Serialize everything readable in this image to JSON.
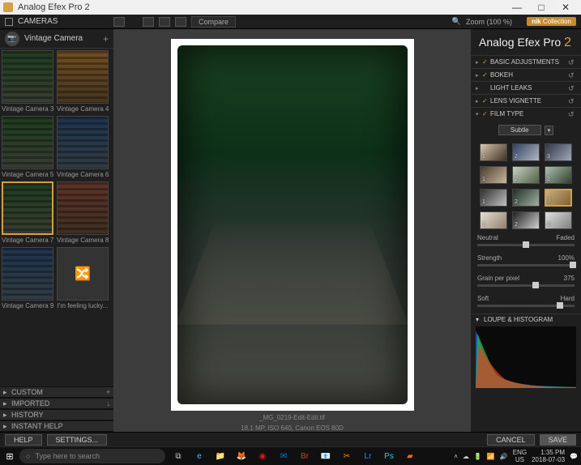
{
  "window": {
    "title": "Analog Efex Pro 2"
  },
  "toolbar": {
    "left_label": "CAMERAS",
    "compare": "Compare",
    "zoom": "Zoom (100 %)",
    "nik": "Collection"
  },
  "camera_header": {
    "label": "Vintage Camera"
  },
  "thumbs": [
    {
      "label": "Vintage Camera 3",
      "tone": ""
    },
    {
      "label": "Vintage Camera 4",
      "tone": "warm"
    },
    {
      "label": "Vintage Camera 5",
      "tone": ""
    },
    {
      "label": "Vintage Camera 6",
      "tone": "blue"
    },
    {
      "label": "Vintage Camera 7",
      "tone": "",
      "selected": true
    },
    {
      "label": "Vintage Camera 8",
      "tone": "red"
    },
    {
      "label": "Vintage Camera 9",
      "tone": "blue"
    },
    {
      "label": "I'm feeling lucky...",
      "lucky": true
    }
  ],
  "sections": {
    "custom": "CUSTOM",
    "imported": "IMPORTED",
    "history": "HISTORY",
    "instant": "INSTANT HELP"
  },
  "image_meta": {
    "filename": "_MG_0219-Edit-Edit.tif",
    "info": "18.1 MP, ISO 640, Canon EOS 80D"
  },
  "right": {
    "app": "Analog Efex Pro",
    "ver": "2",
    "adjustments": [
      {
        "label": "BASIC ADJUSTMENTS",
        "checked": true
      },
      {
        "label": "BOKEH",
        "checked": true
      },
      {
        "label": "LIGHT LEAKS",
        "checked": false
      },
      {
        "label": "LENS VIGNETTE",
        "checked": true
      },
      {
        "label": "FILM TYPE",
        "checked": true,
        "expanded": true
      }
    ],
    "subtle": "Subtle",
    "film_swatches": [
      {
        "n": "1",
        "g": "linear-gradient(135deg,#d8c8b0,#403020)"
      },
      {
        "n": "2",
        "g": "linear-gradient(135deg,#304060,#b0b8c0)"
      },
      {
        "n": "3",
        "g": "linear-gradient(135deg,#303848,#a0a8b8)"
      },
      {
        "n": "1",
        "g": "linear-gradient(135deg,#4a3a2a,#c8b8a0)"
      },
      {
        "n": "2",
        "g": "linear-gradient(135deg,#c8d0c0,#506048)"
      },
      {
        "n": "3",
        "g": "linear-gradient(135deg,#b0c0b0,#304030)"
      },
      {
        "n": "1",
        "g": "linear-gradient(135deg,#303030,#c0c0c0)"
      },
      {
        "n": "2",
        "g": "linear-gradient(135deg,#203028,#a0b0a0)"
      },
      {
        "n": "3",
        "g": "linear-gradient(135deg,#c8b080,#806030)",
        "selected": true
      },
      {
        "n": "1",
        "g": "linear-gradient(135deg,#e8e0d0,#908070)"
      },
      {
        "n": "2",
        "g": "linear-gradient(135deg,#202020,#d0d0d0)"
      },
      {
        "n": "3",
        "g": "linear-gradient(135deg,#e0e0e0,#808080)"
      }
    ],
    "sliders": [
      {
        "left": "Neutral",
        "right": "Faded",
        "pos": 50
      },
      {
        "left": "Strength",
        "right": "100%",
        "pos": 98
      },
      {
        "left": "Grain per pixel",
        "right": "375",
        "pos": 60
      },
      {
        "left": "Soft",
        "right": "Hard",
        "pos": 85
      }
    ],
    "loupe": "LOUPE & HISTOGRAM"
  },
  "bottom": {
    "help": "HELP",
    "settings": "SETTINGS...",
    "cancel": "CANCEL",
    "save": "SAVE"
  },
  "taskbar": {
    "search_placeholder": "Type here to search",
    "lang": "ENG",
    "layout": "US",
    "time": "1:35 PM",
    "date": "2018-07-03"
  }
}
